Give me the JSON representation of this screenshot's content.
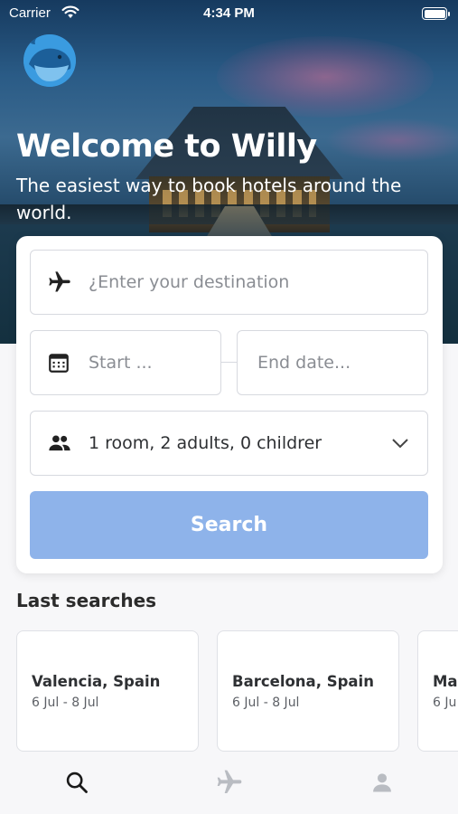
{
  "status_bar": {
    "carrier": "Carrier",
    "time": "4:34 PM",
    "battery_level": 1.0
  },
  "hero": {
    "title": "Welcome to Willy",
    "subtitle": "The easiest way to book hotels around the world."
  },
  "search_form": {
    "destination": {
      "placeholder": "¿Enter your destination",
      "icon": "airplane-icon"
    },
    "start_date": {
      "placeholder": "Start ...",
      "icon": "calendar-icon"
    },
    "end_date": {
      "placeholder": "End date..."
    },
    "guests": {
      "value": "1 room, 2 adults, 0 childrer",
      "icon": "people-icon"
    },
    "search_label": "Search",
    "search_color": "#8eb3ea"
  },
  "last_searches": {
    "title": "Last searches",
    "items": [
      {
        "city": "Valencia, Spain",
        "dates": "6 Jul - 8 Jul"
      },
      {
        "city": "Barcelona, Spain",
        "dates": "6 Jul - 8 Jul"
      },
      {
        "city": "Ma",
        "dates": "6 Ju"
      }
    ]
  },
  "tabbar": {
    "items": [
      {
        "icon": "search-icon",
        "active": true
      },
      {
        "icon": "airplane-icon",
        "active": false
      },
      {
        "icon": "profile-icon",
        "active": false
      }
    ]
  }
}
